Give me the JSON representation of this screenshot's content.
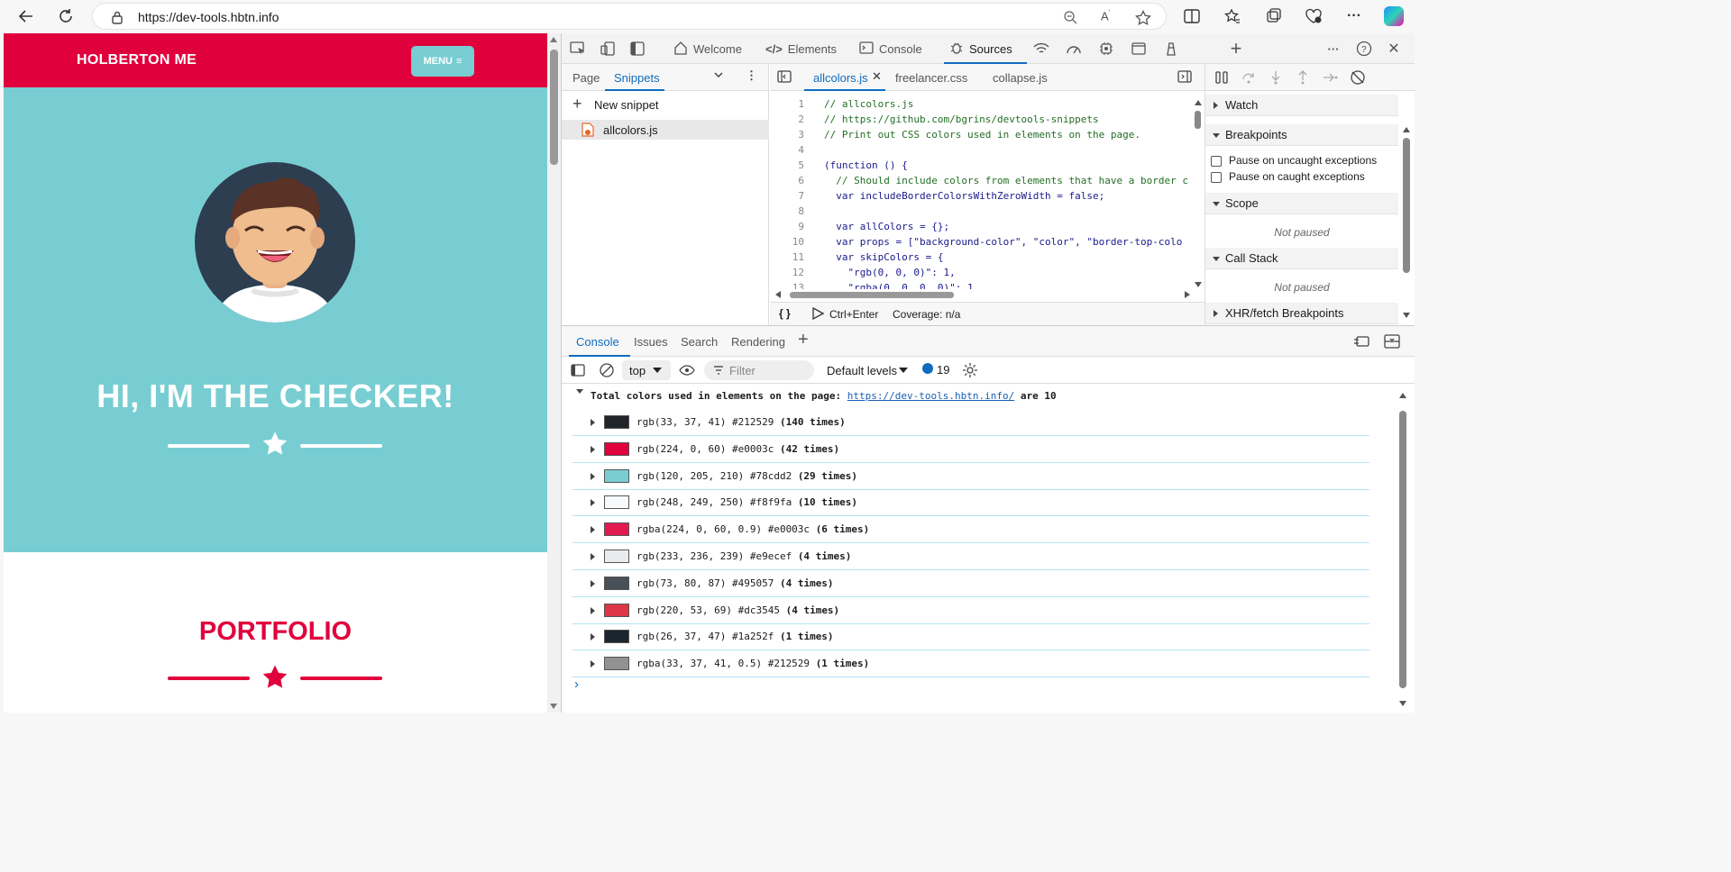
{
  "browser": {
    "url": "https://dev-tools.hbtn.info"
  },
  "page": {
    "brand": "HOLBERTON ME",
    "menu_label": "MENU",
    "hero_title": "HI, I'M THE CHECKER!",
    "section_title": "PORTFOLIO",
    "colors": {
      "primary": "#e0003c",
      "hero": "#78cdd2",
      "avatar_bg": "#2c3e50"
    }
  },
  "devtools": {
    "tabs": [
      "Welcome",
      "Elements",
      "Console",
      "Sources"
    ],
    "active_tab": "Sources",
    "navigator": {
      "tabs": [
        "Page",
        "Snippets"
      ],
      "new_snippet": "New snippet",
      "file": "allcolors.js"
    },
    "editor": {
      "tabs": [
        "allcolors.js",
        "freelancer.css",
        "collapse.js"
      ],
      "lines": [
        {
          "n": "1",
          "t": "// allcolors.js"
        },
        {
          "n": "2",
          "t": "// https://github.com/bgrins/devtools-snippets"
        },
        {
          "n": "3",
          "t": "// Print out CSS colors used in elements on the page."
        },
        {
          "n": "4",
          "t": ""
        },
        {
          "n": "5",
          "t": "(function () {"
        },
        {
          "n": "6",
          "t": "  // Should include colors from elements that have a border c"
        },
        {
          "n": "7",
          "t": "  var includeBorderColorsWithZeroWidth = false;"
        },
        {
          "n": "8",
          "t": ""
        },
        {
          "n": "9",
          "t": "  var allColors = {};"
        },
        {
          "n": "10",
          "t": "  var props = [\"background-color\", \"color\", \"border-top-colo"
        },
        {
          "n": "11",
          "t": "  var skipColors = {"
        },
        {
          "n": "12",
          "t": "    \"rgb(0, 0, 0)\": 1,"
        },
        {
          "n": "13",
          "t": "    \"rgba(0, 0, 0, 0)\": 1,"
        }
      ],
      "footer_run": "Ctrl+Enter",
      "footer_coverage": "Coverage: n/a"
    },
    "debugger": {
      "watch": "Watch",
      "breakpoints": "Breakpoints",
      "pause_uncaught": "Pause on uncaught exceptions",
      "pause_caught": "Pause on caught exceptions",
      "scope": "Scope",
      "scope_state": "Not paused",
      "call_stack": "Call Stack",
      "call_state": "Not paused",
      "xhr": "XHR/fetch Breakpoints"
    },
    "console": {
      "tabs": [
        "Console",
        "Issues",
        "Search",
        "Rendering"
      ],
      "context": "top",
      "filter_placeholder": "Filter",
      "levels": "Default levels",
      "message_count": "19",
      "summary_prefix": "Total colors used in elements on the page: ",
      "summary_link": "https://dev-tools.hbtn.info/",
      "summary_suffix": " are 10",
      "rows": [
        {
          "swatch": "#212529",
          "text": "rgb(33, 37, 41) #212529 ",
          "count": "(140 times)"
        },
        {
          "swatch": "#e0003c",
          "text": "rgb(224, 0, 60) #e0003c ",
          "count": "(42 times)"
        },
        {
          "swatch": "#78cdd2",
          "text": "rgb(120, 205, 210) #78cdd2 ",
          "count": "(29 times)"
        },
        {
          "swatch": "#f8f9fa",
          "text": "rgb(248, 249, 250) #f8f9fa ",
          "count": "(10 times)"
        },
        {
          "swatch": "#e31a50",
          "text": "rgba(224, 0, 60, 0.9) #e0003c ",
          "count": "(6 times)"
        },
        {
          "swatch": "#e9ecef",
          "text": "rgb(233, 236, 239) #e9ecef ",
          "count": "(4 times)"
        },
        {
          "swatch": "#495057",
          "text": "rgb(73, 80, 87) #495057 ",
          "count": "(4 times)"
        },
        {
          "swatch": "#dc3545",
          "text": "rgb(220, 53, 69) #dc3545 ",
          "count": "(4 times)"
        },
        {
          "swatch": "#1a252f",
          "text": "rgb(26, 37, 47) #1a252f ",
          "count": "(1 times)"
        },
        {
          "swatch": "#909294",
          "text": "rgba(33, 37, 41, 0.5) #212529 ",
          "count": "(1 times)"
        }
      ]
    }
  }
}
